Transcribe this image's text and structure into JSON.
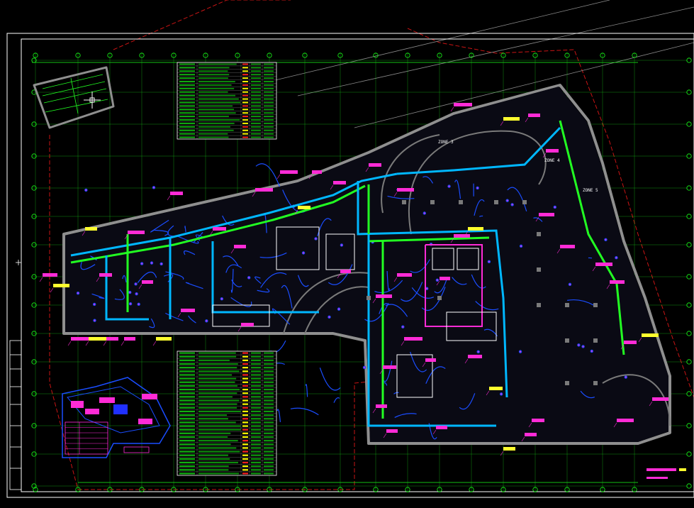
{
  "window": {
    "title": ""
  },
  "drawing": {
    "background": "#000000",
    "colors": {
      "frame": "#ffffff",
      "grid": "#19ff19",
      "wall": "#9a9a9a",
      "duct_blue": "#1a4dff",
      "duct_cyan": "#00e5ff",
      "pipe_green": "#22ff22",
      "tag_magenta": "#ff2bd6",
      "tag_yellow": "#ffff2e",
      "boundary_red": "#d01818",
      "table_green": "#17ff17",
      "table_yellow": "#ffff00"
    },
    "zones": [
      {
        "label": "ZONE 3"
      },
      {
        "label": "ZONE 4"
      },
      {
        "label": "ZONE 5"
      }
    ],
    "icons": {
      "cursor": "crosshair-icon"
    }
  }
}
